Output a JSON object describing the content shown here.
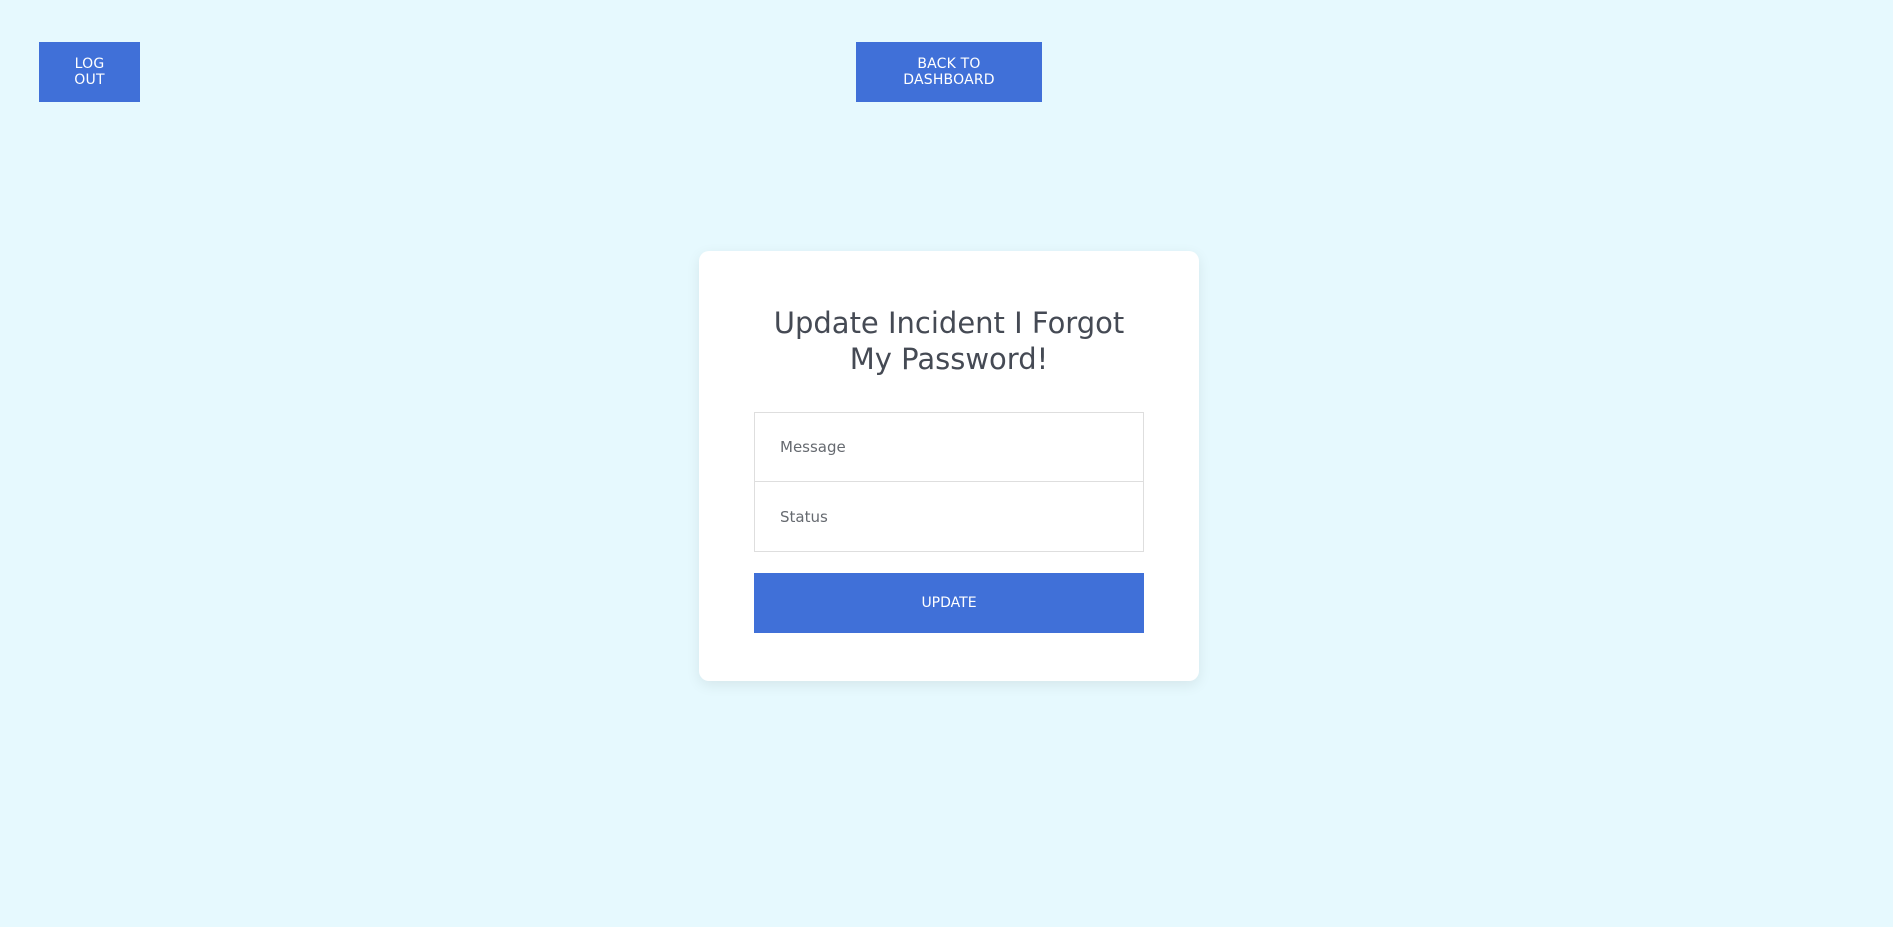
{
  "header": {
    "logout_label": "LOG OUT",
    "dashboard_label": "BACK TO DASHBOARD"
  },
  "form": {
    "title": "Update Incident I Forgot My Password!",
    "message_placeholder": "Message",
    "status_placeholder": "Status",
    "submit_label": "UPDATE"
  },
  "colors": {
    "background": "#e6f9fe",
    "accent": "#4070d8",
    "card": "#ffffff",
    "title_text": "#454a54"
  }
}
